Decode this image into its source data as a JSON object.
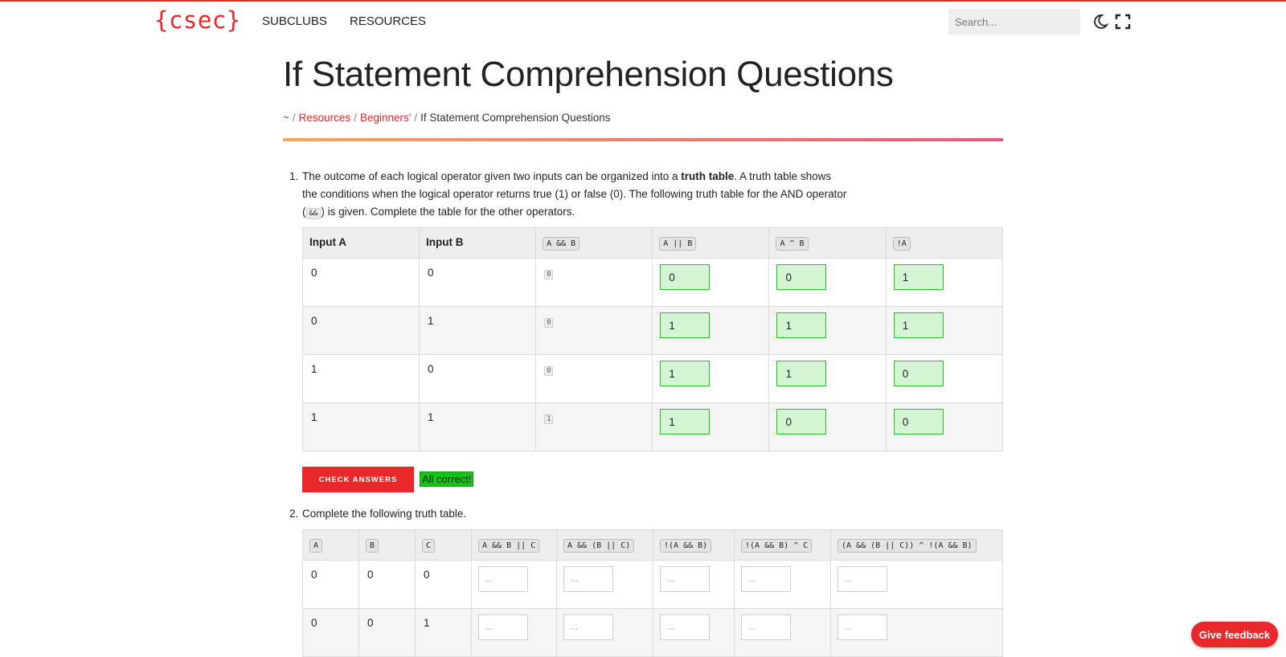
{
  "header": {
    "logo": "{csec}",
    "nav": [
      "SUBCLUBS",
      "RESOURCES"
    ],
    "search_placeholder": "Search...",
    "icons": [
      "moon-icon",
      "fullscreen-icon"
    ]
  },
  "page": {
    "title": "If Statement Comprehension Questions",
    "breadcrumb": [
      "~",
      "Resources",
      "Beginners'",
      "If Statement Comprehension Questions"
    ]
  },
  "q1": {
    "number": "1.",
    "text_1": "The outcome of each logical operator given two inputs can be organized into a ",
    "text_bold": "truth table",
    "text_2": ". A truth table shows the conditions when the logical operator returns true (1) or false (0). The following truth table for the AND operator (",
    "text_code": "&&",
    "text_3": ") is given. Complete the table for the other operators.",
    "headers": [
      "Input A",
      "Input B",
      "A && B",
      "A || B",
      "A ^ B",
      "!A"
    ],
    "rows": [
      {
        "a": "0",
        "b": "0",
        "and": "0",
        "or": "0",
        "xor": "0",
        "not": "1"
      },
      {
        "a": "0",
        "b": "1",
        "and": "0",
        "or": "1",
        "xor": "1",
        "not": "1"
      },
      {
        "a": "1",
        "b": "0",
        "and": "0",
        "or": "1",
        "xor": "1",
        "not": "0"
      },
      {
        "a": "1",
        "b": "1",
        "and": "1",
        "or": "1",
        "xor": "0",
        "not": "0"
      }
    ],
    "check_button": "CHECK ANSWERS",
    "result": "All correct!"
  },
  "q2": {
    "number": "2.",
    "text": "Complete the following truth table.",
    "headers": [
      "A",
      "B",
      "C",
      "A && B || C",
      "A && (B || C)",
      "!(A && B)",
      "!(A && B) ^ C",
      "(A && (B || C)) ^ !(A && B)"
    ],
    "input_placeholder": "...",
    "rows": [
      {
        "a": "0",
        "b": "0",
        "c": "0"
      },
      {
        "a": "0",
        "b": "0",
        "c": "1"
      }
    ]
  },
  "feedback_button": "Give feedback",
  "colors": {
    "accent": "#e8282b",
    "correct_bg": "#d4f5d4",
    "correct_border": "#2bbf2b",
    "result_bg": "#16c416"
  }
}
